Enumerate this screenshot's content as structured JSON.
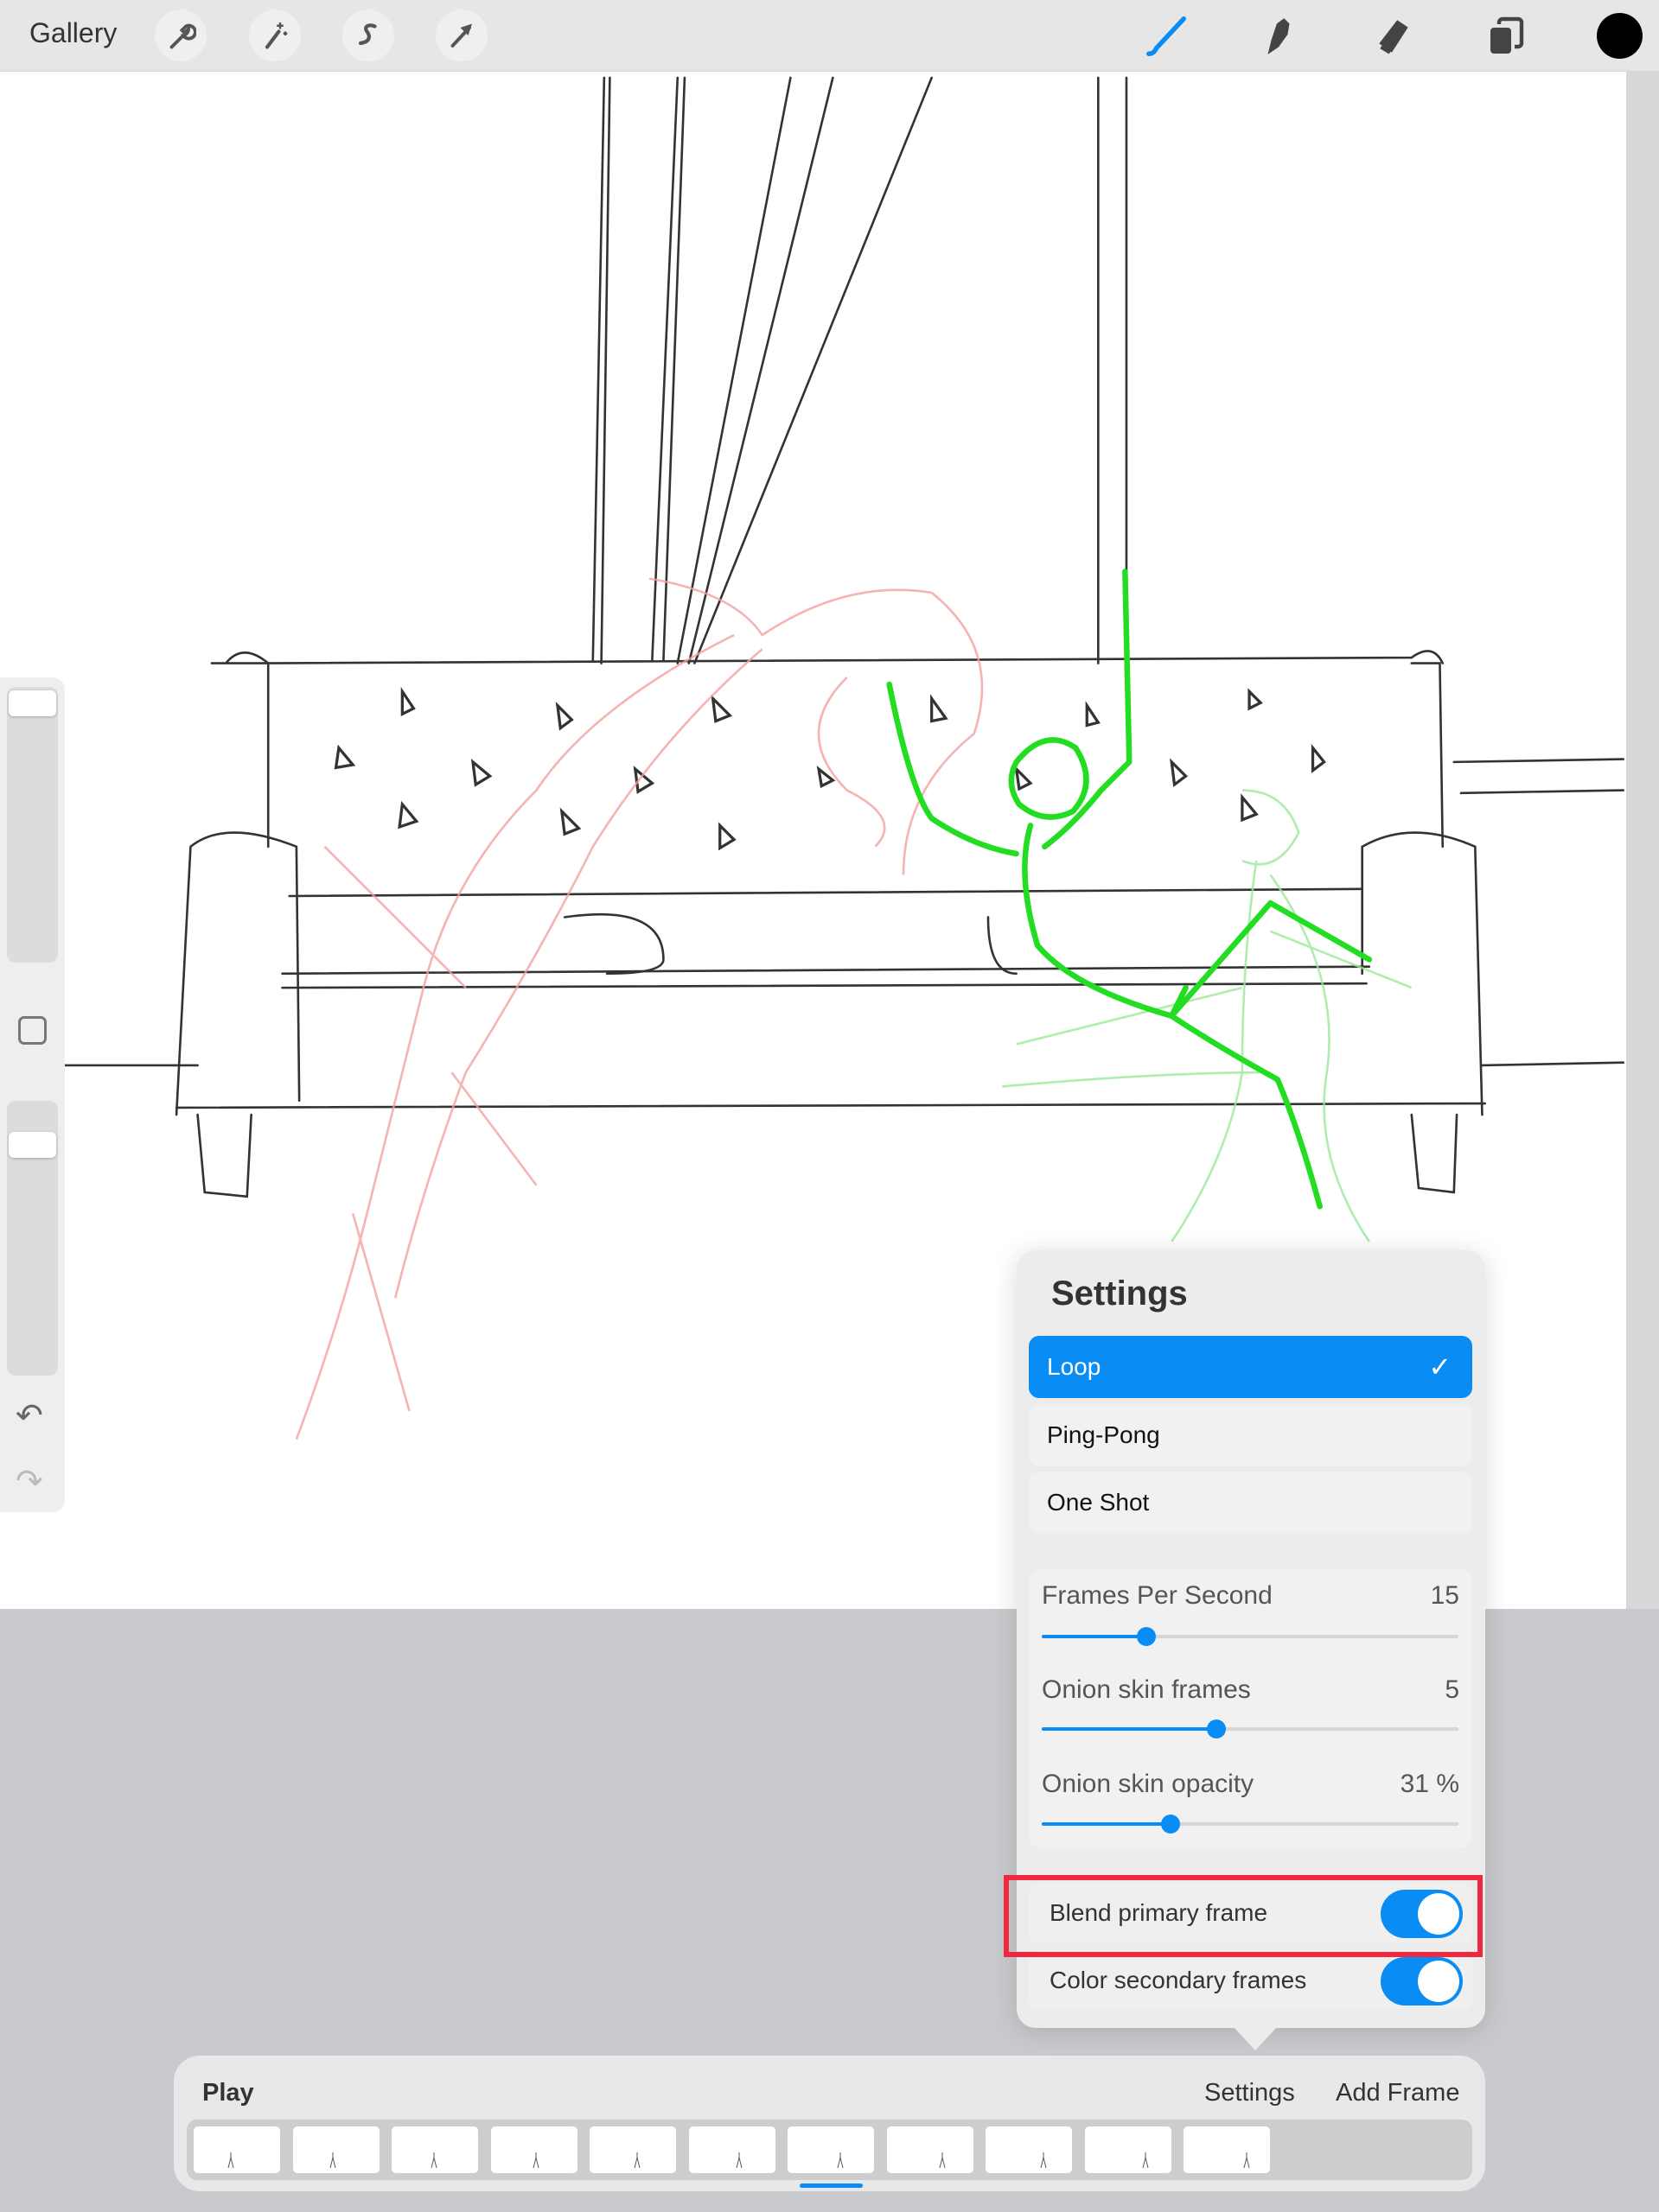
{
  "topbar": {
    "gallery_label": "Gallery",
    "left_tools": [
      "wrench-icon",
      "magic-wand-icon",
      "selection-icon",
      "transform-arrow-icon"
    ],
    "right_tools": [
      "brush-icon",
      "smudge-icon",
      "eraser-icon",
      "layers-icon"
    ],
    "active_tool": "brush",
    "current_color": "#000000"
  },
  "settings": {
    "title": "Settings",
    "modes": [
      {
        "label": "Loop",
        "selected": true
      },
      {
        "label": "Ping-Pong",
        "selected": false
      },
      {
        "label": "One Shot",
        "selected": false
      }
    ],
    "sliders": [
      {
        "label": "Frames Per Second",
        "value": "15",
        "fraction": 0.25
      },
      {
        "label": "Onion skin frames",
        "value": "5",
        "fraction": 0.42
      },
      {
        "label": "Onion skin opacity",
        "value": "31 %",
        "fraction": 0.31
      }
    ],
    "toggles": [
      {
        "label": "Blend primary frame",
        "on": true,
        "highlighted": true
      },
      {
        "label": "Color secondary frames",
        "on": true
      }
    ]
  },
  "timeline": {
    "play_label": "Play",
    "settings_label": "Settings",
    "add_frame_label": "Add Frame",
    "frame_count": 11,
    "selected_frame": 7
  },
  "colors": {
    "accent": "#0a8cf5",
    "highlight_box": "#f0273f",
    "primary_frame": "#22dd22",
    "onion_prev": "#f4a0a0",
    "onion_next": "#9be89b"
  }
}
